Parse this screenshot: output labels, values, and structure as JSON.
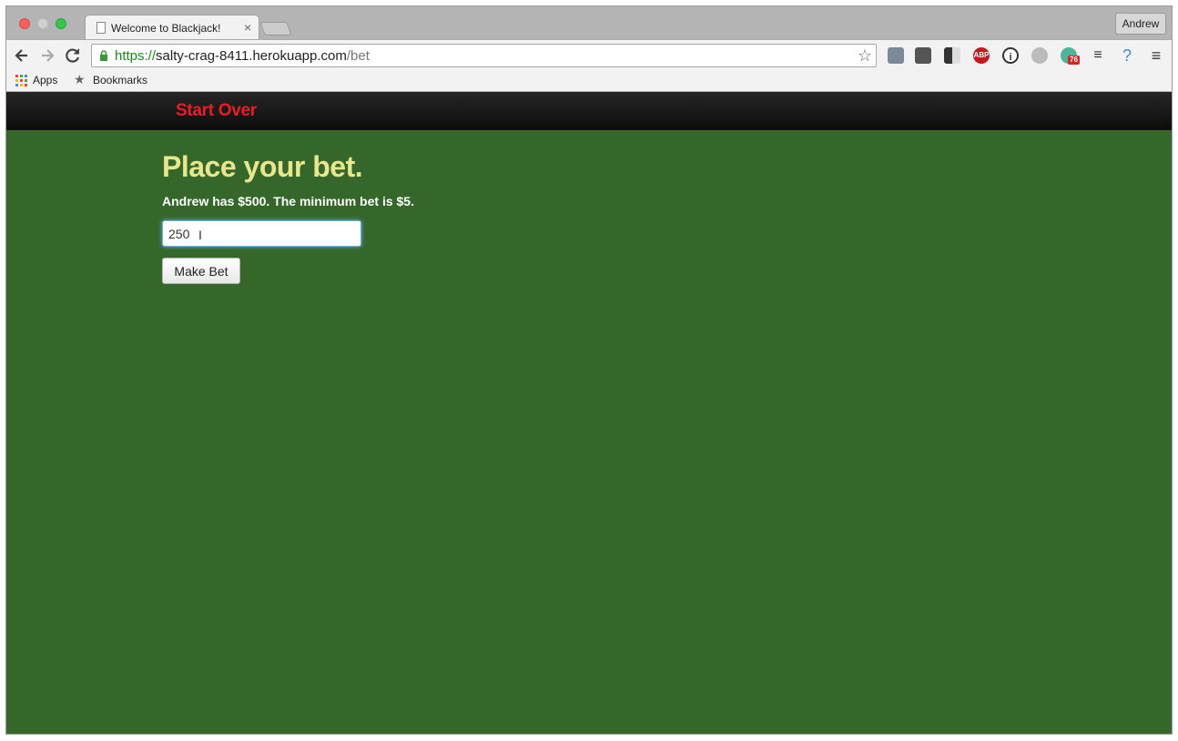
{
  "browser": {
    "tab_title": "Welcome to Blackjack!",
    "tab_close": "×",
    "profile_name": "Andrew",
    "url_scheme": "https://",
    "url_host": "salty-crag-8411.herokuapp.com",
    "url_path": "/bet",
    "bookmarks": {
      "apps_label": "Apps",
      "bookmarks_label": "Bookmarks"
    },
    "extensions": [
      {
        "name": "eyedropper-extension-icon"
      },
      {
        "name": "evernote-extension-icon"
      },
      {
        "name": "delicious-extension-icon"
      },
      {
        "name": "adblock-extension-icon",
        "text": "ABP"
      },
      {
        "name": "onepassword-extension-icon"
      },
      {
        "name": "hangouts-extension-icon"
      },
      {
        "name": "badge-extension-icon",
        "badge": "76"
      },
      {
        "name": "traffic-extension-icon"
      },
      {
        "name": "help-extension-icon",
        "text": "?"
      }
    ]
  },
  "page": {
    "nav": {
      "start_over": "Start Over"
    },
    "heading": "Place your bet.",
    "info": "Andrew has $500. The minimum bet is $5.",
    "bet_input_value": "250",
    "make_bet_label": "Make Bet"
  },
  "colors": {
    "page_background": "#36672a",
    "heading": "#e9e78e",
    "start_over": "#ec1c24",
    "navbar": "#1a1a1a"
  }
}
